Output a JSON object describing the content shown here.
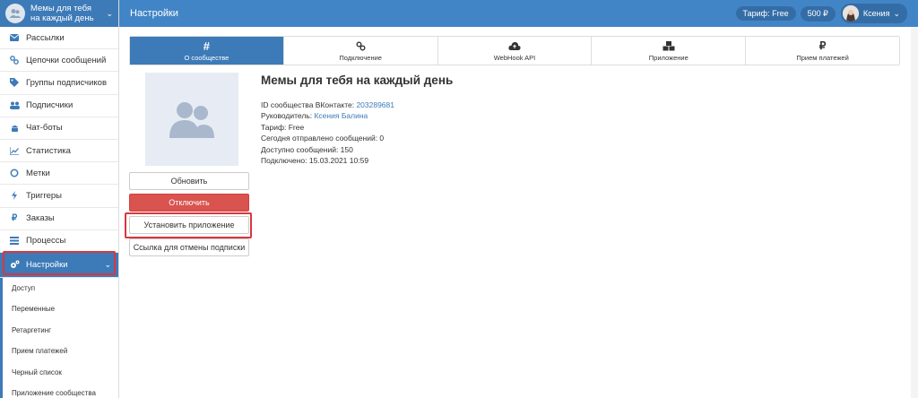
{
  "brand": {
    "name": "Мемы для тебя на каждый день"
  },
  "sidebar": {
    "items": [
      {
        "label": "Рассылки",
        "icon": "envelope-icon"
      },
      {
        "label": "Цепочки сообщений",
        "icon": "link-icon"
      },
      {
        "label": "Группы подписчиков",
        "icon": "tags-icon"
      },
      {
        "label": "Подписчики",
        "icon": "users-icon"
      },
      {
        "label": "Чат-боты",
        "icon": "android-icon"
      },
      {
        "label": "Статистика",
        "icon": "line-chart-icon"
      },
      {
        "label": "Метки",
        "icon": "circle-icon"
      },
      {
        "label": "Триггеры",
        "icon": "bolt-icon"
      },
      {
        "label": "Заказы",
        "icon": "ruble-icon"
      },
      {
        "label": "Процессы",
        "icon": "list-icon"
      },
      {
        "label": "Настройки",
        "icon": "cogs-icon"
      }
    ],
    "subitems": [
      "Доступ",
      "Переменные",
      "Ретаргетинг",
      "Прием платежей",
      "Черный список",
      "Приложение сообщества"
    ]
  },
  "topbar": {
    "title": "Настройки",
    "tariff": "Тариф: Free",
    "balance": "500 ₽",
    "user": "Ксения"
  },
  "tabs": [
    {
      "label": "О сообществе",
      "icon": "hash-icon"
    },
    {
      "label": "Подключение",
      "icon": "link-icon"
    },
    {
      "label": "WebHook API",
      "icon": "cloud-upload-icon"
    },
    {
      "label": "Приложение",
      "icon": "cubes-icon"
    },
    {
      "label": "Прием платежей",
      "icon": "ruble-icon"
    }
  ],
  "buttons": {
    "refresh": "Обновить",
    "disconnect": "Отключить",
    "install_app": "Установить приложение",
    "unsubscribe_link": "Ссылка для отмены подписки"
  },
  "community": {
    "title": "Мемы для тебя на каждый день",
    "vk_id_label": "ID сообщества ВКонтакте: ",
    "vk_id": "203289681",
    "manager_label": "Руководитель: ",
    "manager": "Ксения Балина",
    "tariff": "Тариф: Free",
    "sent_today": "Сегодня отправлено сообщений: 0",
    "available": "Доступно сообщений: 150",
    "connected": "Подключено: 15.03.2021 10:59"
  },
  "colors": {
    "primary": "#3d7ab8",
    "danger": "#d9534f",
    "highlight": "#d9363e"
  }
}
